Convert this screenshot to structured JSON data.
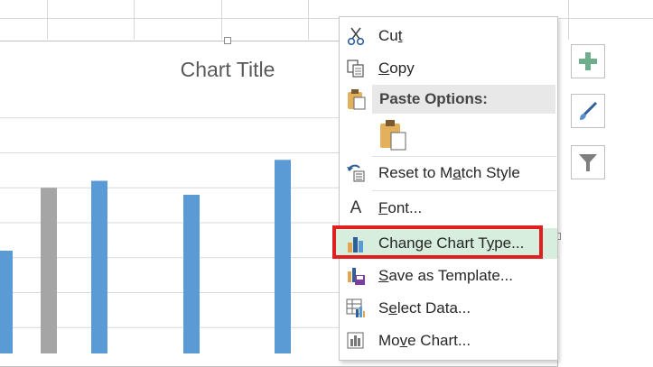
{
  "chart": {
    "title": "Chart Title",
    "series_colors": {
      "blue": "#5b9bd5",
      "gray": "#a5a5a5"
    }
  },
  "chart_data": {
    "type": "bar",
    "title": "Chart Title",
    "xlabel": "",
    "ylabel": "",
    "bars": [
      {
        "series": "blue",
        "value": 1.6
      },
      {
        "series": "gray",
        "value": 2.5
      },
      {
        "series": "blue",
        "value": 2.6
      },
      {
        "series": "blue",
        "value": 2.4
      },
      {
        "series": "blue",
        "value": 2.9
      }
    ],
    "ylim": [
      0,
      4
    ],
    "grid": true
  },
  "side_buttons": [
    {
      "icon": "plus-icon",
      "color": "#6fae8c"
    },
    {
      "icon": "paintbrush-icon",
      "color": "#2f5f98"
    },
    {
      "icon": "filter-icon",
      "color": "#7f7f7f"
    }
  ],
  "context_menu": {
    "items": [
      {
        "key": "cut",
        "pre": "Cu",
        "u": "t",
        "post": "",
        "icon": "scissors-icon"
      },
      {
        "key": "copy",
        "pre": "",
        "u": "C",
        "post": "opy",
        "icon": "copy-icon"
      },
      {
        "key": "paste_header",
        "label": "Paste Options:",
        "icon": "clipboard-icon"
      },
      {
        "key": "paste_option",
        "icon": "paste-clipboard-icon"
      },
      {
        "key": "reset_style",
        "pre": "Reset to M",
        "u": "a",
        "post": "tch Style",
        "icon": "reset-style-icon"
      },
      {
        "key": "font",
        "pre": "",
        "u": "F",
        "post": "ont...",
        "icon": "font-icon",
        "icon_text": "A"
      },
      {
        "key": "change_chart_type",
        "pre": "Change Chart T",
        "u": "y",
        "post": "pe...",
        "icon": "chart-type-icon",
        "highlighted": true
      },
      {
        "key": "save_template",
        "pre": "",
        "u": "S",
        "post": "ave as Template...",
        "icon": "save-template-icon"
      },
      {
        "key": "select_data",
        "pre": "S",
        "u": "e",
        "post": "lect Data...",
        "icon": "select-data-icon"
      },
      {
        "key": "move_chart",
        "pre": "Mo",
        "u": "v",
        "post": "e Chart...",
        "icon": "move-chart-icon"
      }
    ]
  },
  "highlight_color": "#e02020"
}
